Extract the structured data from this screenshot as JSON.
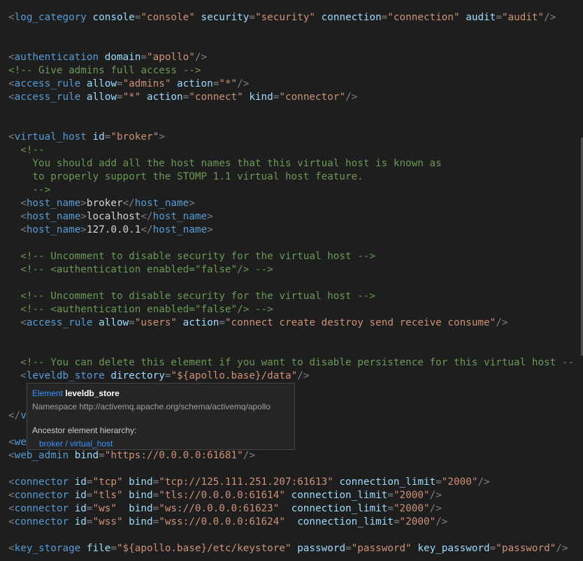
{
  "editor": {
    "lines": [
      [
        [
          "t-punct",
          "<"
        ],
        [
          "t-tag",
          "log_category"
        ],
        [
          "t-text",
          " "
        ],
        [
          "t-attr",
          "console"
        ],
        [
          "t-punct",
          "="
        ],
        [
          "t-str",
          "\"console\""
        ],
        [
          "t-text",
          " "
        ],
        [
          "t-attr",
          "security"
        ],
        [
          "t-punct",
          "="
        ],
        [
          "t-str",
          "\"security\""
        ],
        [
          "t-text",
          " "
        ],
        [
          "t-attr",
          "connection"
        ],
        [
          "t-punct",
          "="
        ],
        [
          "t-str",
          "\"connection\""
        ],
        [
          "t-text",
          " "
        ],
        [
          "t-attr",
          "audit"
        ],
        [
          "t-punct",
          "="
        ],
        [
          "t-str",
          "\"audit\""
        ],
        [
          "t-punct",
          "/>"
        ]
      ],
      [],
      [],
      [
        [
          "t-punct",
          "<"
        ],
        [
          "t-tag",
          "authentication"
        ],
        [
          "t-text",
          " "
        ],
        [
          "t-attr",
          "domain"
        ],
        [
          "t-punct",
          "="
        ],
        [
          "t-str",
          "\"apollo\""
        ],
        [
          "t-punct",
          "/>"
        ]
      ],
      [
        [
          "t-comment",
          "<!-- Give admins full access -->"
        ]
      ],
      [
        [
          "t-punct",
          "<"
        ],
        [
          "t-tag",
          "access_rule"
        ],
        [
          "t-text",
          " "
        ],
        [
          "t-attr",
          "allow"
        ],
        [
          "t-punct",
          "="
        ],
        [
          "t-str",
          "\"admins\""
        ],
        [
          "t-text",
          " "
        ],
        [
          "t-attr",
          "action"
        ],
        [
          "t-punct",
          "="
        ],
        [
          "t-str",
          "\"*\""
        ],
        [
          "t-punct",
          "/>"
        ]
      ],
      [
        [
          "t-punct",
          "<"
        ],
        [
          "t-tag",
          "access_rule"
        ],
        [
          "t-text",
          " "
        ],
        [
          "t-attr",
          "allow"
        ],
        [
          "t-punct",
          "="
        ],
        [
          "t-str",
          "\"*\""
        ],
        [
          "t-text",
          " "
        ],
        [
          "t-attr",
          "action"
        ],
        [
          "t-punct",
          "="
        ],
        [
          "t-str",
          "\"connect\""
        ],
        [
          "t-text",
          " "
        ],
        [
          "t-attr",
          "kind"
        ],
        [
          "t-punct",
          "="
        ],
        [
          "t-str",
          "\"connector\""
        ],
        [
          "t-punct",
          "/>"
        ]
      ],
      [],
      [],
      [
        [
          "t-punct",
          "<"
        ],
        [
          "t-tag",
          "virtual_host"
        ],
        [
          "t-text",
          " "
        ],
        [
          "t-attr",
          "id"
        ],
        [
          "t-punct",
          "="
        ],
        [
          "t-str",
          "\"broker\""
        ],
        [
          "t-punct",
          ">"
        ]
      ],
      [
        [
          "t-text",
          "  "
        ],
        [
          "t-comment",
          "<!--"
        ]
      ],
      [
        [
          "t-comment",
          "    You should add all the host names that this virtual host is known as"
        ]
      ],
      [
        [
          "t-comment",
          "    to properly support the STOMP 1.1 virtual host feature."
        ]
      ],
      [
        [
          "t-comment",
          "    -->"
        ]
      ],
      [
        [
          "t-text",
          "  "
        ],
        [
          "t-punct",
          "<"
        ],
        [
          "t-tag",
          "host_name"
        ],
        [
          "t-punct",
          ">"
        ],
        [
          "t-text",
          "broker"
        ],
        [
          "t-punct",
          "</"
        ],
        [
          "t-tag",
          "host_name"
        ],
        [
          "t-punct",
          ">"
        ]
      ],
      [
        [
          "t-text",
          "  "
        ],
        [
          "t-punct",
          "<"
        ],
        [
          "t-tag",
          "host_name"
        ],
        [
          "t-punct",
          ">"
        ],
        [
          "t-text",
          "localhost"
        ],
        [
          "t-punct",
          "</"
        ],
        [
          "t-tag",
          "host_name"
        ],
        [
          "t-punct",
          ">"
        ]
      ],
      [
        [
          "t-text",
          "  "
        ],
        [
          "t-punct",
          "<"
        ],
        [
          "t-tag",
          "host_name"
        ],
        [
          "t-punct",
          ">"
        ],
        [
          "t-text",
          "127.0.0.1"
        ],
        [
          "t-punct",
          "</"
        ],
        [
          "t-tag",
          "host_name"
        ],
        [
          "t-punct",
          ">"
        ]
      ],
      [],
      [
        [
          "t-text",
          "  "
        ],
        [
          "t-comment",
          "<!-- Uncomment to disable security for the virtual host -->"
        ]
      ],
      [
        [
          "t-text",
          "  "
        ],
        [
          "t-comment",
          "<!-- <authentication enabled=\"false\"/> -->"
        ]
      ],
      [],
      [
        [
          "t-text",
          "  "
        ],
        [
          "t-comment",
          "<!-- Uncomment to disable security for the virtual host -->"
        ]
      ],
      [
        [
          "t-text",
          "  "
        ],
        [
          "t-comment",
          "<!-- <authentication enabled=\"false\"/> -->"
        ]
      ],
      [
        [
          "t-text",
          "  "
        ],
        [
          "t-punct",
          "<"
        ],
        [
          "t-tag",
          "access_rule"
        ],
        [
          "t-text",
          " "
        ],
        [
          "t-attr",
          "allow"
        ],
        [
          "t-punct",
          "="
        ],
        [
          "t-str",
          "\"users\""
        ],
        [
          "t-text",
          " "
        ],
        [
          "t-attr",
          "action"
        ],
        [
          "t-punct",
          "="
        ],
        [
          "t-str",
          "\"connect create destroy send receive consume\""
        ],
        [
          "t-punct",
          "/>"
        ]
      ],
      [],
      [],
      [
        [
          "t-text",
          "  "
        ],
        [
          "t-comment",
          "<!-- You can delete this element if you want to disable persistence for this virtual host --"
        ]
      ],
      [
        [
          "t-text",
          "  "
        ],
        [
          "t-punct",
          "<"
        ],
        [
          "t-tag",
          "leveldb_store"
        ],
        [
          "t-text",
          " "
        ],
        [
          "t-attr",
          "directory"
        ],
        [
          "t-punct",
          "="
        ],
        [
          "t-str",
          "\"${apollo.base}/data\""
        ],
        [
          "t-punct",
          "/>"
        ]
      ],
      [],
      [],
      [
        [
          "t-punct",
          "</"
        ],
        [
          "t-tag",
          "v"
        ]
      ],
      [],
      [
        [
          "t-punct",
          "<"
        ],
        [
          "t-tag",
          "we"
        ]
      ],
      [
        [
          "t-punct",
          "<"
        ],
        [
          "t-tag",
          "web_admin"
        ],
        [
          "t-text",
          " "
        ],
        [
          "t-attr",
          "bind"
        ],
        [
          "t-punct",
          "="
        ],
        [
          "t-str",
          "\"https://0.0.0.0:61681\""
        ],
        [
          "t-punct",
          "/>"
        ]
      ],
      [],
      [
        [
          "t-punct",
          "<"
        ],
        [
          "t-tag",
          "connector"
        ],
        [
          "t-text",
          " "
        ],
        [
          "t-attr",
          "id"
        ],
        [
          "t-punct",
          "="
        ],
        [
          "t-str",
          "\"tcp\""
        ],
        [
          "t-text",
          " "
        ],
        [
          "t-attr",
          "bind"
        ],
        [
          "t-punct",
          "="
        ],
        [
          "t-str",
          "\"tcp://125.111.251.207:61613\""
        ],
        [
          "t-text",
          " "
        ],
        [
          "t-attr",
          "connection_limit"
        ],
        [
          "t-punct",
          "="
        ],
        [
          "t-str",
          "\"2000\""
        ],
        [
          "t-punct",
          "/>"
        ]
      ],
      [
        [
          "t-punct",
          "<"
        ],
        [
          "t-tag",
          "connector"
        ],
        [
          "t-text",
          " "
        ],
        [
          "t-attr",
          "id"
        ],
        [
          "t-punct",
          "="
        ],
        [
          "t-str",
          "\"tls\""
        ],
        [
          "t-text",
          " "
        ],
        [
          "t-attr",
          "bind"
        ],
        [
          "t-punct",
          "="
        ],
        [
          "t-str",
          "\"tls://0.0.0.0:61614\""
        ],
        [
          "t-text",
          " "
        ],
        [
          "t-attr",
          "connection_limit"
        ],
        [
          "t-punct",
          "="
        ],
        [
          "t-str",
          "\"2000\""
        ],
        [
          "t-punct",
          "/>"
        ]
      ],
      [
        [
          "t-punct",
          "<"
        ],
        [
          "t-tag",
          "connector"
        ],
        [
          "t-text",
          " "
        ],
        [
          "t-attr",
          "id"
        ],
        [
          "t-punct",
          "="
        ],
        [
          "t-str",
          "\"ws\""
        ],
        [
          "t-text",
          "  "
        ],
        [
          "t-attr",
          "bind"
        ],
        [
          "t-punct",
          "="
        ],
        [
          "t-str",
          "\"ws://0.0.0.0:61623\""
        ],
        [
          "t-text",
          "  "
        ],
        [
          "t-attr",
          "connection_limit"
        ],
        [
          "t-punct",
          "="
        ],
        [
          "t-str",
          "\"2000\""
        ],
        [
          "t-punct",
          "/>"
        ]
      ],
      [
        [
          "t-punct",
          "<"
        ],
        [
          "t-tag",
          "connector"
        ],
        [
          "t-text",
          " "
        ],
        [
          "t-attr",
          "id"
        ],
        [
          "t-punct",
          "="
        ],
        [
          "t-str",
          "\"wss\""
        ],
        [
          "t-text",
          " "
        ],
        [
          "t-attr",
          "bind"
        ],
        [
          "t-punct",
          "="
        ],
        [
          "t-str",
          "\"wss://0.0.0.0:61624\""
        ],
        [
          "t-text",
          "  "
        ],
        [
          "t-attr",
          "connection_limit"
        ],
        [
          "t-punct",
          "="
        ],
        [
          "t-str",
          "\"2000\""
        ],
        [
          "t-punct",
          "/>"
        ]
      ],
      [],
      [
        [
          "t-punct",
          "<"
        ],
        [
          "t-tag",
          "key_storage"
        ],
        [
          "t-text",
          " "
        ],
        [
          "t-attr",
          "file"
        ],
        [
          "t-punct",
          "="
        ],
        [
          "t-str",
          "\"${apollo.base}/etc/keystore\""
        ],
        [
          "t-text",
          " "
        ],
        [
          "t-attr",
          "password"
        ],
        [
          "t-punct",
          "="
        ],
        [
          "t-str",
          "\"password\""
        ],
        [
          "t-text",
          " "
        ],
        [
          "t-attr",
          "key_password"
        ],
        [
          "t-punct",
          "="
        ],
        [
          "t-str",
          "\"password\""
        ],
        [
          "t-punct",
          "/>"
        ]
      ]
    ]
  },
  "tooltip": {
    "kind": "Element",
    "name": "leveldb_store",
    "namespace": "Namespace http://activemq.apache.org/schema/activemq/apollo",
    "ancestor_title": "Ancestor element hierarchy:",
    "ancestor_path": "broker / virtual_host"
  },
  "colors": {
    "background": "#1e1e1e",
    "tag": "#569cd6",
    "attribute": "#9cdcfe",
    "string": "#ce9178",
    "comment": "#6a9955",
    "punctuation": "#808080",
    "text": "#d4d4d4",
    "tooltip_link": "#3794ff"
  }
}
